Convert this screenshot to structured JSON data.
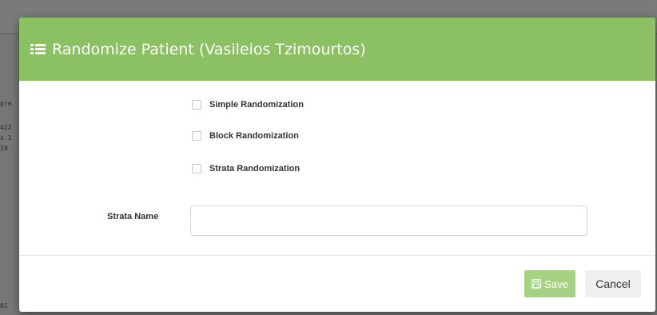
{
  "background": {
    "fragments": [
      "gra",
      "422",
      "s 1",
      "19",
      "01"
    ]
  },
  "modal": {
    "title": "Randomize Patient (Vasileios Tzimourtos)",
    "title_icon": "list-icon",
    "close_icon": "close-icon",
    "header_color": "#8bc163",
    "options": [
      {
        "label": "Simple Randomization",
        "checked": false
      },
      {
        "label": "Block Randomization",
        "checked": false
      },
      {
        "label": "Strata Randomization",
        "checked": false
      }
    ],
    "strata_name": {
      "label": "Strata Name",
      "value": "",
      "placeholder": ""
    },
    "buttons": {
      "save_label": "Save",
      "save_icon": "floppy-disk-icon",
      "cancel_label": "Cancel"
    }
  }
}
